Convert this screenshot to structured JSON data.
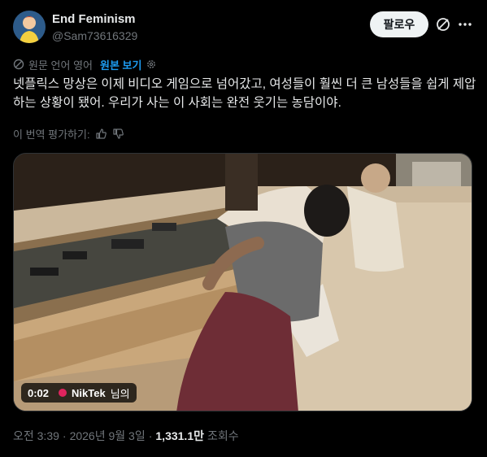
{
  "author": {
    "name": "End Feminism",
    "handle": "@Sam73616329"
  },
  "actions": {
    "follow_label": "팔로우"
  },
  "translation": {
    "note": "원문 언어 영어",
    "show_original": "원본 보기"
  },
  "tweet": {
    "text": "넷플릭스 망상은 이제 비디오 게임으로 넘어갔고, 여성들이 훨씬 더 큰 남성들을 쉽게 제압하는 상황이 됐어. 우리가 사는 이 사회는 완전 웃기는 농담이야."
  },
  "rating": {
    "label": "이 번역 평가하기:"
  },
  "media": {
    "timestamp": "0:02",
    "credit_name": "NikTek",
    "credit_suffix": "님의"
  },
  "meta": {
    "time": "오전 3:39",
    "date": "2026년 9월 3일",
    "views": "1,331.1만",
    "views_label": "조회수",
    "separator": "·"
  },
  "colors": {
    "background": "#000000",
    "text": "#e7e9ea",
    "secondary": "#71767b",
    "link": "#1d9bf0",
    "follow_bg": "#eff3f4"
  }
}
